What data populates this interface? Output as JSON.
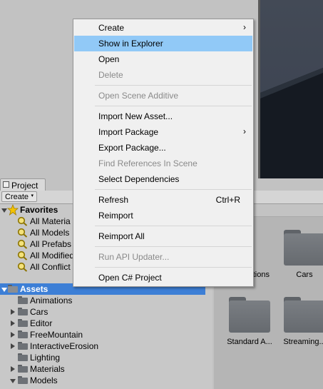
{
  "context_menu": {
    "items": [
      {
        "label": "Create",
        "submenu": true,
        "disabled": false
      },
      {
        "label": "Show in Explorer",
        "highlighted": true,
        "disabled": false
      },
      {
        "label": "Open",
        "disabled": false
      },
      {
        "label": "Delete",
        "disabled": true
      },
      {
        "label": "Open Scene Additive",
        "disabled": true
      },
      {
        "label": "Import New Asset...",
        "disabled": false
      },
      {
        "label": "Import Package",
        "submenu": true,
        "disabled": false
      },
      {
        "label": "Export Package...",
        "disabled": false
      },
      {
        "label": "Find References In Scene",
        "disabled": true
      },
      {
        "label": "Select Dependencies",
        "disabled": false
      },
      {
        "label": "Refresh",
        "shortcut": "Ctrl+R",
        "disabled": false
      },
      {
        "label": "Reimport",
        "disabled": false
      },
      {
        "label": "Reimport All",
        "disabled": false
      },
      {
        "label": "Run API Updater...",
        "disabled": true
      },
      {
        "label": "Open C# Project",
        "disabled": false
      }
    ],
    "submenu_glyph": "›",
    "highlight_color": "#91c9f7"
  },
  "project_panel": {
    "tab_label": "Project",
    "create_label": "Create",
    "create_arrow": "▾",
    "favorites": {
      "label": "Favorites",
      "items": [
        "All Materia",
        "All Models",
        "All Prefabs",
        "All Modified",
        "All Conflict"
      ]
    },
    "assets": {
      "label": "Assets",
      "children": [
        "Animations",
        "Cars",
        "Editor",
        "FreeMountain",
        "InteractiveErosion",
        "Lighting",
        "Materials",
        "Models"
      ]
    },
    "grid_items": [
      "tions",
      "Cars",
      "Standard A...",
      "Streaming..."
    ],
    "selection_color": "#3d7fd6"
  }
}
